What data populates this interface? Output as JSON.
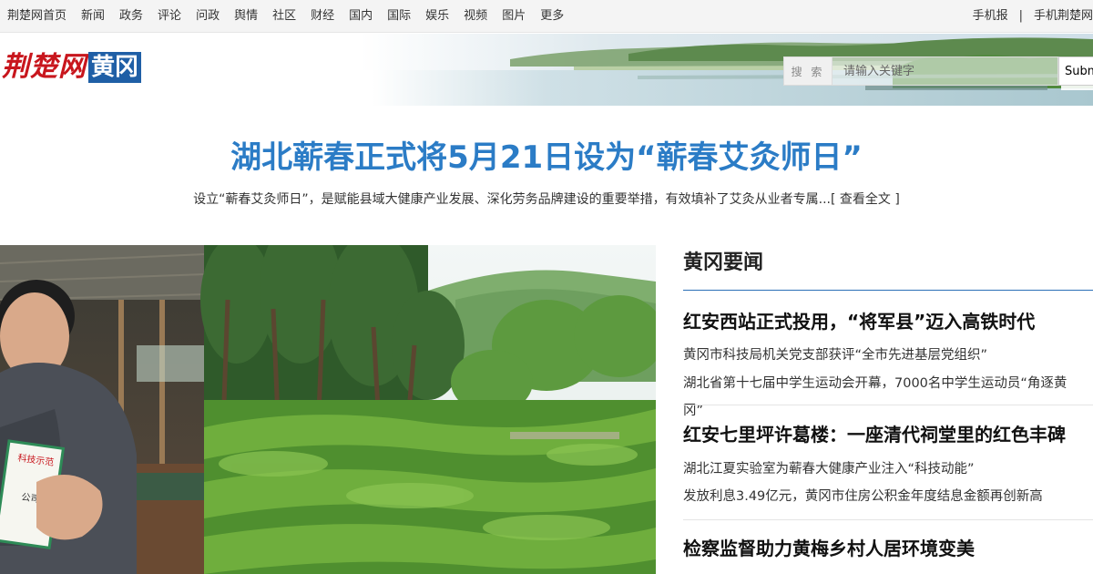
{
  "topnav": {
    "links": [
      "荆楚网首页",
      "新闻",
      "政务",
      "评论",
      "问政",
      "舆情",
      "社区",
      "财经",
      "国内",
      "国际",
      "娱乐",
      "视频",
      "图片",
      "更多"
    ],
    "right": [
      "手机报",
      "|",
      "手机荆楚网"
    ]
  },
  "header": {
    "brand": "荆楚网",
    "region": "黄冈",
    "search": {
      "label": "搜 索",
      "placeholder": "请输入关键字",
      "submit": "Submit"
    }
  },
  "headline": {
    "title": "湖北蕲春正式将5月21日设为“蕲春艾灸师日”",
    "summary": "设立“蕲春艾灸师日”，是赋能县域大健康产业发展、深化劳务品牌建设的重要举措，有效填补了艾灸从业者专属...",
    "more": "[ 查看全文 ]"
  },
  "photo": {
    "certificate_lines": [
      "科技示范",
      "公司"
    ]
  },
  "news": {
    "section_title": "黄冈要闻",
    "items": [
      {
        "title": "红安西站正式投用，“将军县”迈入高铁时代",
        "subs": [
          "黄冈市科技局机关党支部获评“全市先进基层党组织”",
          "湖北省第十七届中学生运动会开幕，7000名中学生运动员“角逐黄冈”"
        ]
      },
      {
        "title": "红安七里坪许葛楼：一座清代祠堂里的红色丰碑",
        "subs": [
          "湖北江夏实验室为蕲春大健康产业注入“科技动能”",
          "发放利息3.49亿元，黄冈市住房公积金年度结息金额再创新高"
        ]
      },
      {
        "title": "检察监督助力黄梅乡村人居环境变美",
        "subs": []
      }
    ]
  },
  "colors": {
    "headline": "#2b7cc6",
    "brand_red": "#c8161d",
    "region_blue": "#1f5fa6",
    "rule_blue": "#2b6fb6"
  }
}
